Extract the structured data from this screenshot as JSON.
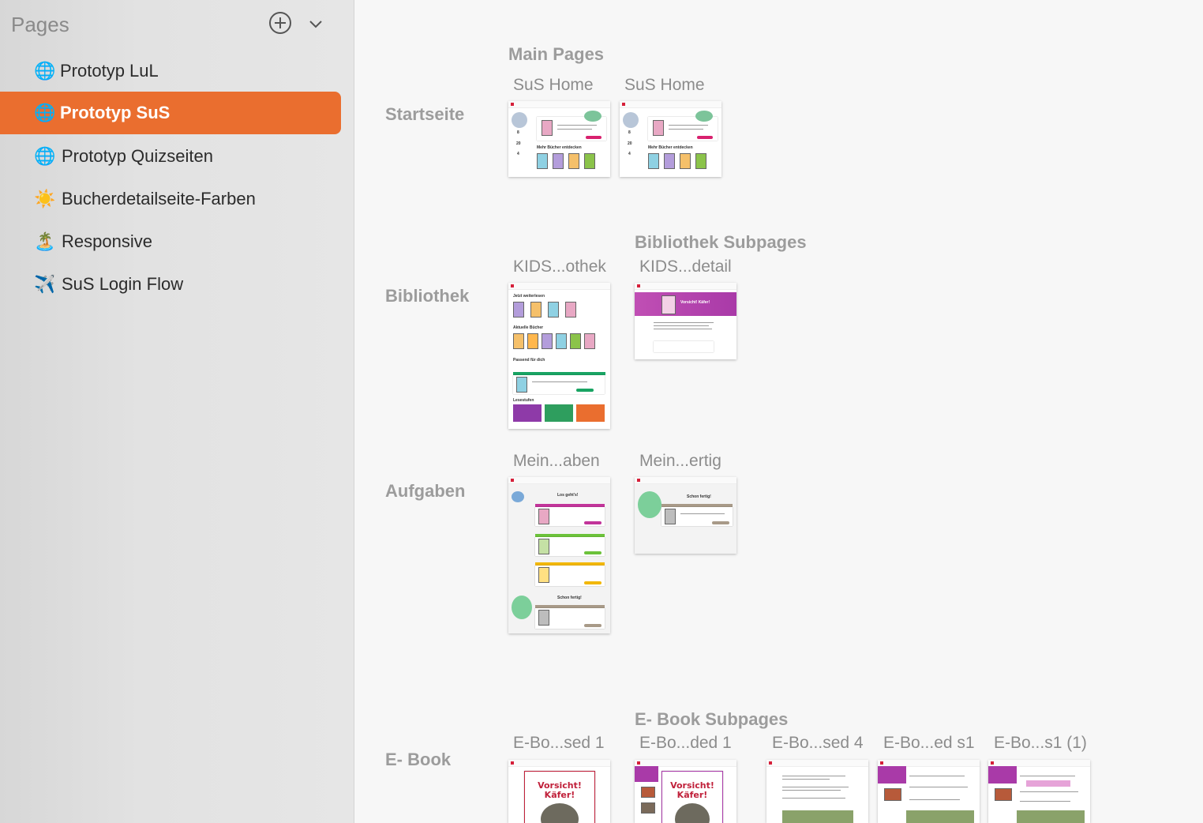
{
  "sidebar": {
    "title": "Pages",
    "add_icon": "plus-circle-icon",
    "collapse_icon": "chevron-down-icon",
    "items": [
      {
        "emoji": "🌐",
        "label": "Prototyp LuL",
        "active": false
      },
      {
        "emoji": "🌐",
        "label": "Prototyp SuS",
        "active": true
      },
      {
        "emoji": "🌐",
        "label": "Prototyp Quizseiten",
        "active": false
      },
      {
        "emoji": "☀️",
        "label": "Bucherdetailseite-Farben",
        "active": false
      },
      {
        "emoji": "🏝️",
        "label": "Responsive",
        "active": false
      },
      {
        "emoji": "✈️",
        "label": "SuS Login Flow",
        "active": false
      }
    ]
  },
  "canvas": {
    "sections": {
      "startseite": "Startseite",
      "bibliothek": "Bibliothek",
      "aufgaben": "Aufgaben",
      "ebook": "E- Book"
    },
    "groups": {
      "main_pages": "Main Pages",
      "bibliothek_subpages": "Bibliothek Subpages",
      "ebook_subpages": "E- Book Subpages"
    },
    "frames": {
      "sus_home_1": "SuS Home",
      "sus_home_2": "SuS Home",
      "kids_othek": "KIDS...othek",
      "kids_detail": "KIDS...detail",
      "mein_aben": "Mein...aben",
      "mein_ertig": "Mein...ertig",
      "ebook_sed1": "E-Bo...sed 1",
      "ebook_ded1": "E-Bo...ded 1",
      "ebook_sed4": "E-Bo...sed 4",
      "ebook_eds1": "E-Bo...ed s1",
      "ebook_s1_1": "E-Bo...s1 (1)"
    },
    "thumb_text": {
      "mehr_buecher": "Mehr Bücher entdecken",
      "vorsicht_kaefer": "Vorsicht! Käfer!",
      "jetzt_weiterlesen": "Jetzt weiterlesen",
      "aktuelle_buecher": "Aktuelle Bücher",
      "passend": "Passend für dich",
      "lesestufen": "Lesestufen",
      "los_gehts": "Los geht's!",
      "schon_fertig": "Schon fertig!",
      "stat_8": "8",
      "stat_20": "20",
      "stat_4": "4"
    }
  }
}
